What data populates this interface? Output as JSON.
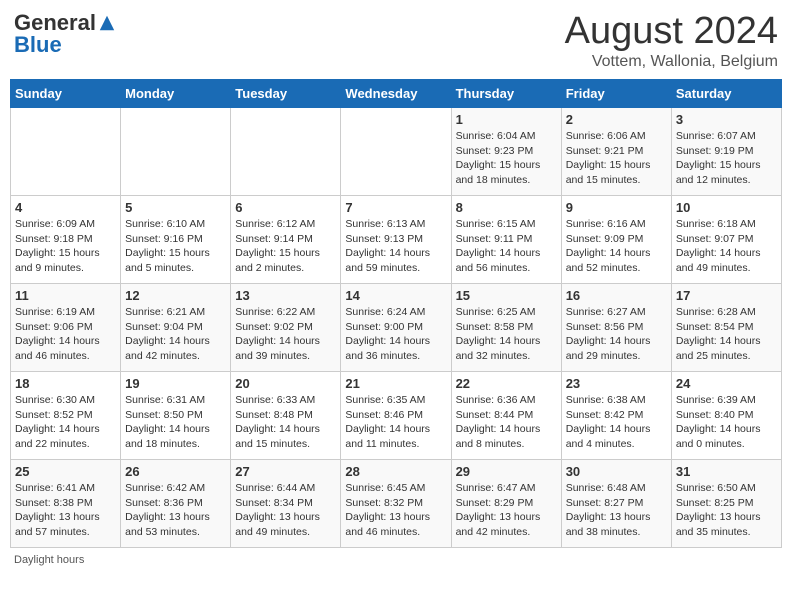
{
  "header": {
    "logo_general": "General",
    "logo_blue": "Blue",
    "main_title": "August 2024",
    "subtitle": "Vottem, Wallonia, Belgium"
  },
  "days_of_week": [
    "Sunday",
    "Monday",
    "Tuesday",
    "Wednesday",
    "Thursday",
    "Friday",
    "Saturday"
  ],
  "weeks": [
    {
      "days": [
        {
          "number": "",
          "info": ""
        },
        {
          "number": "",
          "info": ""
        },
        {
          "number": "",
          "info": ""
        },
        {
          "number": "",
          "info": ""
        },
        {
          "number": "1",
          "info": "Sunrise: 6:04 AM\nSunset: 9:23 PM\nDaylight: 15 hours\nand 18 minutes."
        },
        {
          "number": "2",
          "info": "Sunrise: 6:06 AM\nSunset: 9:21 PM\nDaylight: 15 hours\nand 15 minutes."
        },
        {
          "number": "3",
          "info": "Sunrise: 6:07 AM\nSunset: 9:19 PM\nDaylight: 15 hours\nand 12 minutes."
        }
      ]
    },
    {
      "days": [
        {
          "number": "4",
          "info": "Sunrise: 6:09 AM\nSunset: 9:18 PM\nDaylight: 15 hours\nand 9 minutes."
        },
        {
          "number": "5",
          "info": "Sunrise: 6:10 AM\nSunset: 9:16 PM\nDaylight: 15 hours\nand 5 minutes."
        },
        {
          "number": "6",
          "info": "Sunrise: 6:12 AM\nSunset: 9:14 PM\nDaylight: 15 hours\nand 2 minutes."
        },
        {
          "number": "7",
          "info": "Sunrise: 6:13 AM\nSunset: 9:13 PM\nDaylight: 14 hours\nand 59 minutes."
        },
        {
          "number": "8",
          "info": "Sunrise: 6:15 AM\nSunset: 9:11 PM\nDaylight: 14 hours\nand 56 minutes."
        },
        {
          "number": "9",
          "info": "Sunrise: 6:16 AM\nSunset: 9:09 PM\nDaylight: 14 hours\nand 52 minutes."
        },
        {
          "number": "10",
          "info": "Sunrise: 6:18 AM\nSunset: 9:07 PM\nDaylight: 14 hours\nand 49 minutes."
        }
      ]
    },
    {
      "days": [
        {
          "number": "11",
          "info": "Sunrise: 6:19 AM\nSunset: 9:06 PM\nDaylight: 14 hours\nand 46 minutes."
        },
        {
          "number": "12",
          "info": "Sunrise: 6:21 AM\nSunset: 9:04 PM\nDaylight: 14 hours\nand 42 minutes."
        },
        {
          "number": "13",
          "info": "Sunrise: 6:22 AM\nSunset: 9:02 PM\nDaylight: 14 hours\nand 39 minutes."
        },
        {
          "number": "14",
          "info": "Sunrise: 6:24 AM\nSunset: 9:00 PM\nDaylight: 14 hours\nand 36 minutes."
        },
        {
          "number": "15",
          "info": "Sunrise: 6:25 AM\nSunset: 8:58 PM\nDaylight: 14 hours\nand 32 minutes."
        },
        {
          "number": "16",
          "info": "Sunrise: 6:27 AM\nSunset: 8:56 PM\nDaylight: 14 hours\nand 29 minutes."
        },
        {
          "number": "17",
          "info": "Sunrise: 6:28 AM\nSunset: 8:54 PM\nDaylight: 14 hours\nand 25 minutes."
        }
      ]
    },
    {
      "days": [
        {
          "number": "18",
          "info": "Sunrise: 6:30 AM\nSunset: 8:52 PM\nDaylight: 14 hours\nand 22 minutes."
        },
        {
          "number": "19",
          "info": "Sunrise: 6:31 AM\nSunset: 8:50 PM\nDaylight: 14 hours\nand 18 minutes."
        },
        {
          "number": "20",
          "info": "Sunrise: 6:33 AM\nSunset: 8:48 PM\nDaylight: 14 hours\nand 15 minutes."
        },
        {
          "number": "21",
          "info": "Sunrise: 6:35 AM\nSunset: 8:46 PM\nDaylight: 14 hours\nand 11 minutes."
        },
        {
          "number": "22",
          "info": "Sunrise: 6:36 AM\nSunset: 8:44 PM\nDaylight: 14 hours\nand 8 minutes."
        },
        {
          "number": "23",
          "info": "Sunrise: 6:38 AM\nSunset: 8:42 PM\nDaylight: 14 hours\nand 4 minutes."
        },
        {
          "number": "24",
          "info": "Sunrise: 6:39 AM\nSunset: 8:40 PM\nDaylight: 14 hours\nand 0 minutes."
        }
      ]
    },
    {
      "days": [
        {
          "number": "25",
          "info": "Sunrise: 6:41 AM\nSunset: 8:38 PM\nDaylight: 13 hours\nand 57 minutes."
        },
        {
          "number": "26",
          "info": "Sunrise: 6:42 AM\nSunset: 8:36 PM\nDaylight: 13 hours\nand 53 minutes."
        },
        {
          "number": "27",
          "info": "Sunrise: 6:44 AM\nSunset: 8:34 PM\nDaylight: 13 hours\nand 49 minutes."
        },
        {
          "number": "28",
          "info": "Sunrise: 6:45 AM\nSunset: 8:32 PM\nDaylight: 13 hours\nand 46 minutes."
        },
        {
          "number": "29",
          "info": "Sunrise: 6:47 AM\nSunset: 8:29 PM\nDaylight: 13 hours\nand 42 minutes."
        },
        {
          "number": "30",
          "info": "Sunrise: 6:48 AM\nSunset: 8:27 PM\nDaylight: 13 hours\nand 38 minutes."
        },
        {
          "number": "31",
          "info": "Sunrise: 6:50 AM\nSunset: 8:25 PM\nDaylight: 13 hours\nand 35 minutes."
        }
      ]
    }
  ],
  "footer": {
    "note": "Daylight hours"
  }
}
